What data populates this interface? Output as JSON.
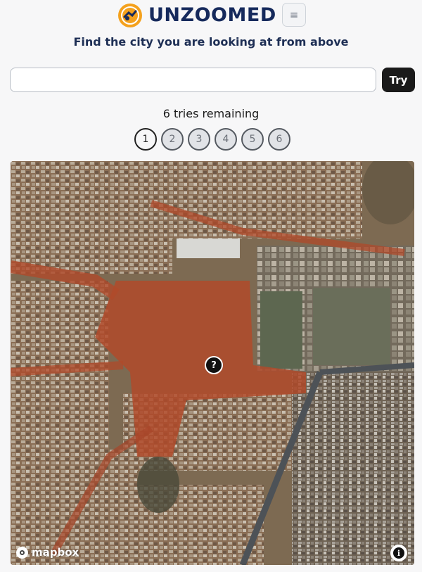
{
  "app": {
    "name": "UNZOOMED",
    "tagline": "Find the city you are looking at from above",
    "accent_color": "#162a5c",
    "logo_color": "#f4a11d"
  },
  "menu": {
    "icon": "hamburger-icon",
    "glyph": "≡"
  },
  "guess": {
    "value": "",
    "placeholder": "",
    "button_label": "Try"
  },
  "tries": {
    "remaining_text": "6 tries remaining",
    "slots": [
      "1",
      "2",
      "3",
      "4",
      "5",
      "6"
    ],
    "current": 1
  },
  "map": {
    "marker_glyph": "?",
    "attribution_logo": "mapbox",
    "info_glyph": "i"
  }
}
